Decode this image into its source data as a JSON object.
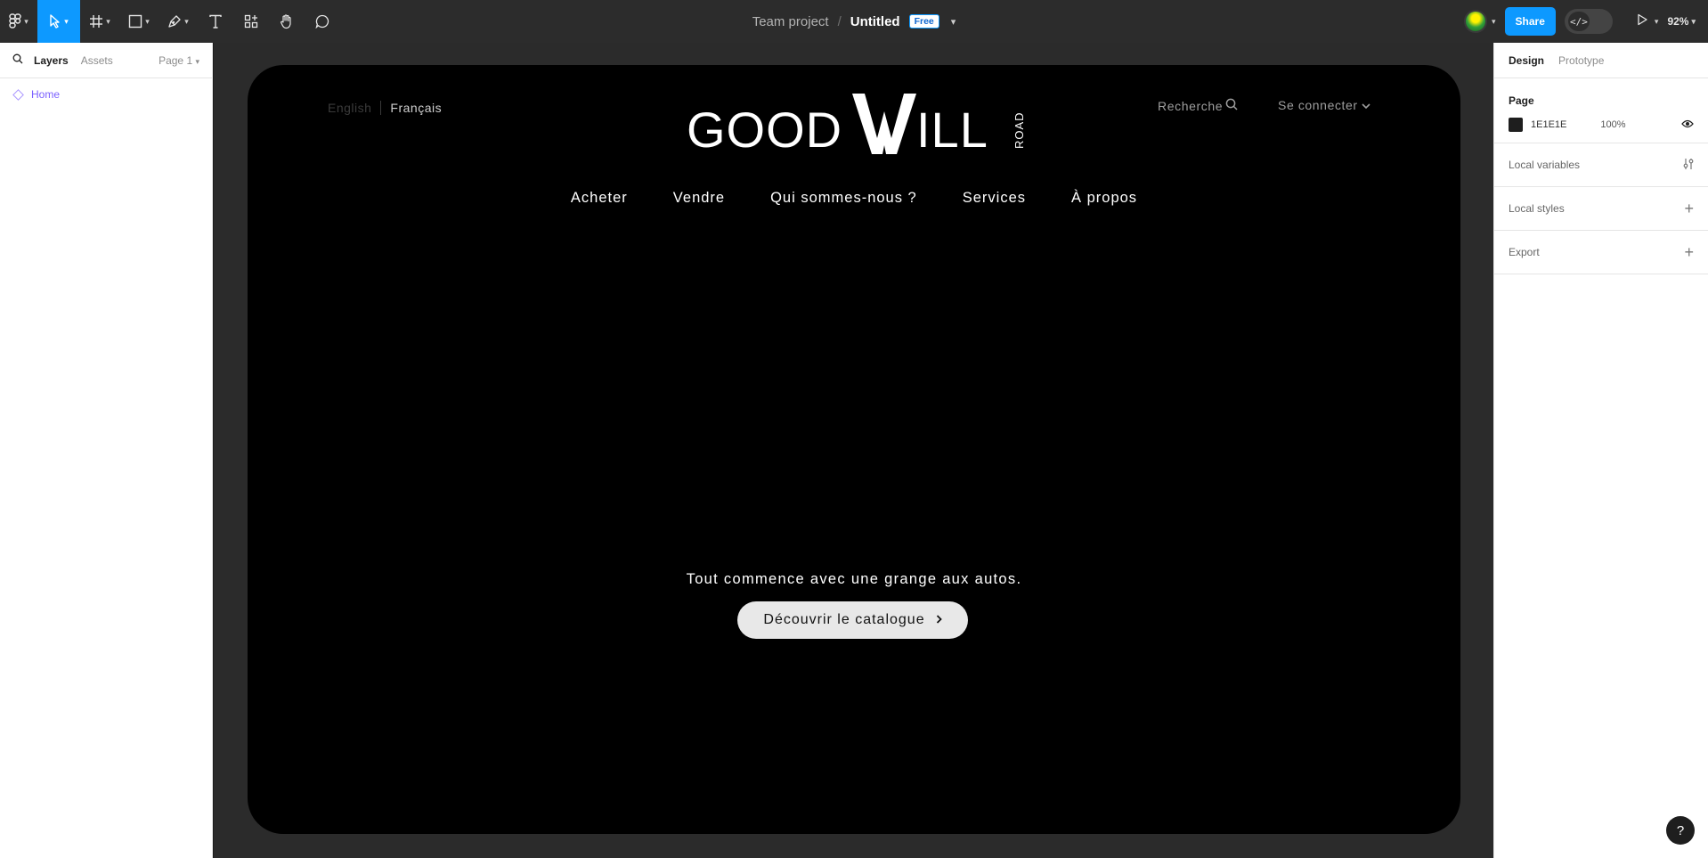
{
  "toolbar": {
    "tools": [
      {
        "name": "main-menu",
        "icon": "figma-logo-icon"
      },
      {
        "name": "move-tool",
        "icon": "cursor-icon",
        "active": true
      },
      {
        "name": "frame-tool",
        "icon": "frame-icon"
      },
      {
        "name": "shape-tool",
        "icon": "rectangle-icon"
      },
      {
        "name": "pen-tool",
        "icon": "pen-icon"
      },
      {
        "name": "text-tool",
        "icon": "text-icon"
      },
      {
        "name": "resources-tool",
        "icon": "components-icon"
      },
      {
        "name": "hand-tool",
        "icon": "hand-icon"
      },
      {
        "name": "comment-tool",
        "icon": "comment-icon"
      }
    ],
    "project": "Team project",
    "separator": "/",
    "file_name": "Untitled",
    "plan_badge": "Free",
    "share_label": "Share",
    "dev_mode_glyph": "</>",
    "zoom": "92%"
  },
  "left_panel": {
    "tab_layers": "Layers",
    "tab_assets": "Assets",
    "page_selector": "Page 1",
    "layers": [
      "Home"
    ]
  },
  "right_panel": {
    "tab_design": "Design",
    "tab_prototype": "Prototype",
    "page_heading": "Page",
    "page_fill_hex": "1E1E1E",
    "page_fill_opacity": "100%",
    "local_variables": "Local variables",
    "local_styles": "Local styles",
    "export": "Export"
  },
  "site": {
    "lang_en": "English",
    "lang_fr": "Français",
    "logo_left": "GOOD",
    "logo_right": "ILL",
    "logo_road": "ROAD",
    "search_label": "Recherche",
    "login_label": "Se connecter",
    "nav": [
      "Acheter",
      "Vendre",
      "Qui sommes-nous ?",
      "Services",
      "À propos"
    ],
    "tagline": "Tout commence avec une grange aux autos.",
    "cta_label": "Découvrir le catalogue"
  },
  "help_label": "?",
  "colors": {
    "accent": "#0d99ff",
    "page_fill": "#1E1E1E",
    "layer_purple": "#7b61ff",
    "frame_bg": "#000000"
  }
}
